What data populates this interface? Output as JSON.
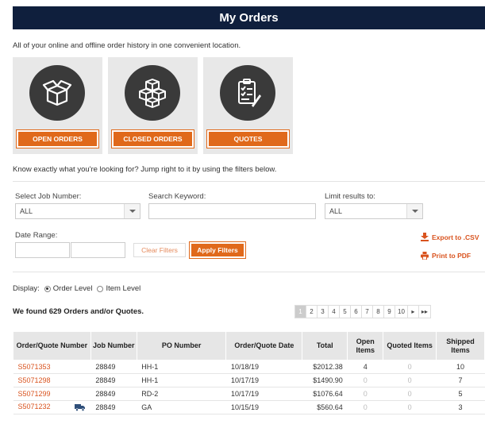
{
  "header": {
    "title": "My Orders"
  },
  "intro": "All of your online and offline order history in one convenient location.",
  "tiles": [
    {
      "label": "OPEN ORDERS",
      "icon": "open-box-icon"
    },
    {
      "label": "CLOSED ORDERS",
      "icon": "stacked-boxes-icon"
    },
    {
      "label": "QUOTES",
      "icon": "quote-document-icon"
    }
  ],
  "know_text": "Know exactly what you're looking for? Jump right to it by using the filters below.",
  "filters": {
    "job_label": "Select Job Number:",
    "job_value": "ALL",
    "keyword_label": "Search Keyword:",
    "keyword_value": "",
    "limit_label": "Limit results to:",
    "limit_value": "ALL",
    "date_label": "Date Range:",
    "clear_label": "Clear Filters",
    "apply_label": "Apply Filters",
    "export_label": "Export to .CSV",
    "print_label": "Print to PDF"
  },
  "display": {
    "label": "Display:",
    "order_level": "Order Level",
    "item_level": "Item Level",
    "selected": "order"
  },
  "found_text": "We found 629 Orders and/or Quotes.",
  "pagination": [
    "1",
    "2",
    "3",
    "4",
    "5",
    "6",
    "7",
    "8",
    "9",
    "10",
    "▸",
    "▸▸"
  ],
  "table": {
    "headers": [
      "Order/Quote Number",
      "Job Number",
      "PO Number",
      "Order/Quote Date",
      "Total",
      "Open Items",
      "Quoted Items",
      "Shipped Items"
    ],
    "rows": [
      {
        "order": "S5071353",
        "job": "28849",
        "po": "HH-1",
        "date": "10/18/19",
        "total": "$2012.38",
        "open": "4",
        "quoted": "0",
        "shipped": "10",
        "truck": false
      },
      {
        "order": "S5071298",
        "job": "28849",
        "po": "HH-1",
        "date": "10/17/19",
        "total": "$1490.90",
        "open": "0",
        "quoted": "0",
        "shipped": "7",
        "truck": false
      },
      {
        "order": "S5071299",
        "job": "28849",
        "po": "RD-2",
        "date": "10/17/19",
        "total": "$1076.64",
        "open": "0",
        "quoted": "0",
        "shipped": "5",
        "truck": false
      },
      {
        "order": "S5071232",
        "job": "28849",
        "po": "GA",
        "date": "10/15/19",
        "total": "$560.64",
        "open": "0",
        "quoted": "0",
        "shipped": "3",
        "truck": true
      }
    ]
  },
  "colors": {
    "header_bg": "#0f1f3d",
    "accent": "#e0691b",
    "link": "#d9531e"
  }
}
